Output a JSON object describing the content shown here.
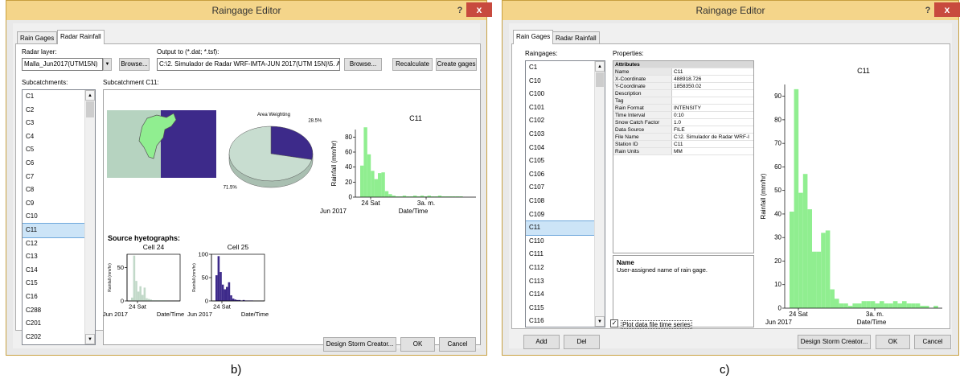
{
  "captions": {
    "left": "b)",
    "right": "c)"
  },
  "left": {
    "title": "Raingage Editor",
    "help": "?",
    "close": "x",
    "tabs": [
      "Rain Gages",
      "Radar Rainfall"
    ],
    "radar_layer_label": "Radar layer:",
    "radar_layer_value": "Malla_Jun2017(UTM15N)",
    "dropdown": "▼",
    "browse1": "Browse...",
    "output_label": "Output to (*.dat; *.tsf):",
    "output_value": "C:\\2. Simulador de Radar WRF-IMTA-JUN 2017(UTM 15N)\\5. Archivos",
    "browse2": "Browse...",
    "recalculate": "Recalculate",
    "create_gages": "Create gages",
    "subcatchments_label": "Subcatchments:",
    "subcatchments": [
      "C1",
      "C2",
      "C3",
      "C4",
      "C5",
      "C6",
      "C7",
      "C8",
      "C9",
      "C10",
      "C11",
      "C12",
      "C13",
      "C14",
      "C15",
      "C16",
      "C288",
      "C201",
      "C202"
    ],
    "selected": "C11",
    "subcatchment_title": "Subcatchment C11:",
    "area_weighting": "Area Weighting",
    "source_hyetographs": "Source hyetographs:",
    "buttons": {
      "design": "Design Storm Creator...",
      "ok": "OK",
      "cancel": "Cancel"
    }
  },
  "right": {
    "title": "Raingage Editor",
    "help": "?",
    "close": "x",
    "tabs": [
      "Rain Gages",
      "Radar Rainfall"
    ],
    "raingages_label": "Raingages:",
    "raingages": [
      "C1",
      "C10",
      "C100",
      "C101",
      "C102",
      "C103",
      "C104",
      "C105",
      "C106",
      "C107",
      "C108",
      "C109",
      "C11",
      "C110",
      "C111",
      "C112",
      "C113",
      "C114",
      "C115",
      "C116"
    ],
    "selected": "C11",
    "properties_label": "Properties:",
    "properties_header": "Attributes",
    "properties": [
      [
        "Name",
        "C11"
      ],
      [
        "X-Coordinate",
        "488918.726"
      ],
      [
        "Y-Coordinate",
        "1858350.02"
      ],
      [
        "Description",
        ""
      ],
      [
        "Tag",
        ""
      ],
      [
        "Rain Format",
        "INTENSITY"
      ],
      [
        "Time Interval",
        "0:10"
      ],
      [
        "Snow Catch Factor",
        "1.0"
      ],
      [
        "Data Source",
        "FILE"
      ],
      [
        "File Name",
        "C:\\2. Simulador de Radar WRF-I"
      ],
      [
        "Station ID",
        "C11"
      ],
      [
        "Rain Units",
        "MM"
      ]
    ],
    "desc_title": "Name",
    "desc_text": "User-assigned name of rain gage.",
    "plot_checkbox": "Plot data file time series",
    "add": "Add",
    "del": "Del",
    "buttons": {
      "design": "Design Storm Creator...",
      "ok": "OK",
      "cancel": "Cancel"
    }
  },
  "chart_data": [
    {
      "type": "bar",
      "title": "C11",
      "ylabel": "Rainfall (mm/hr)",
      "xlabel": "Date/Time",
      "ylim": [
        0,
        90
      ],
      "yticks": [
        0,
        20,
        40,
        60,
        80
      ],
      "xticks": [
        "24 Sat",
        "3a. m."
      ],
      "xsub": "Jun 2017",
      "color": "#90ee90",
      "values": [
        42,
        93,
        57,
        35,
        24,
        32,
        33,
        8,
        4,
        2,
        1,
        1,
        2,
        1,
        1,
        2,
        1,
        2,
        1,
        2,
        1,
        1,
        2,
        1,
        1,
        1,
        1,
        1,
        1,
        0
      ]
    },
    {
      "type": "pie",
      "title": "Area Weighting",
      "slices": [
        {
          "label": "28.5%",
          "value": 28.5,
          "color": "#3d2a8a"
        },
        {
          "label": "71.5%",
          "value": 71.5,
          "color": "#c8ddd0"
        }
      ]
    },
    {
      "type": "bar",
      "title": "Cell 24",
      "ylabel": "Rainfall (mm/hr)",
      "xlabel": "Date/Time",
      "ylim": [
        0,
        70
      ],
      "yticks": [
        0,
        50
      ],
      "xticks": [
        "24 Sat"
      ],
      "xsub": "Jun 2017",
      "color": "#c2d9c9",
      "values": [
        5,
        68,
        30,
        14,
        22,
        9,
        20,
        4,
        3,
        2,
        1,
        1,
        1,
        1,
        1,
        1,
        1,
        0
      ]
    },
    {
      "type": "bar",
      "title": "Cell 25",
      "ylabel": "Rainfall (mm/hr)",
      "xlabel": "Date/Time",
      "ylim": [
        0,
        100
      ],
      "yticks": [
        0,
        50,
        100
      ],
      "xticks": [
        "24 Sat"
      ],
      "xsub": "Jun 2017",
      "color": "#3d2a8a",
      "values": [
        55,
        96,
        62,
        35,
        25,
        30,
        40,
        12,
        5,
        3,
        2,
        2,
        1,
        2,
        1,
        1,
        1,
        1
      ]
    },
    {
      "type": "bar",
      "title": "C11",
      "ylabel": "Rainfall (mm/hr)",
      "xlabel": "Date/Time",
      "ylim": [
        0,
        95
      ],
      "yticks": [
        0,
        10,
        20,
        30,
        40,
        50,
        60,
        70,
        80,
        90
      ],
      "xticks": [
        "24 Sat",
        "3a. m."
      ],
      "xsub": "Jun 2017",
      "color": "#90ee90",
      "values": [
        41,
        93,
        49,
        57,
        42,
        24,
        24,
        32,
        33,
        8,
        4,
        2,
        2,
        1,
        2,
        2,
        3,
        3,
        3,
        2,
        3,
        2,
        2,
        3,
        2,
        3,
        2,
        2,
        2,
        1,
        1,
        0,
        1
      ]
    }
  ]
}
